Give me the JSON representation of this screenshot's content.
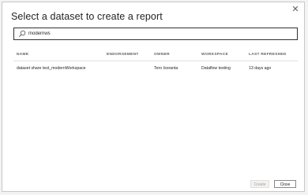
{
  "dialog": {
    "title": "Select a dataset to create a report",
    "close_glyph": "✕"
  },
  "search": {
    "value": "modernws",
    "icon": "search-icon"
  },
  "table": {
    "columns": {
      "name": "NAME",
      "endorsement": "ENDORSEMENT",
      "owner": "OWNER",
      "workspace": "WORKSPACE",
      "last_refreshed": "LAST REFRESHED"
    },
    "rows": [
      {
        "name": "dataset share test_modernWorkspace",
        "endorsement": "",
        "owner": "Tero Isoranta",
        "workspace": "Dataflow testing",
        "last_refreshed": "13 days ago"
      }
    ]
  },
  "buttons": {
    "create": "Create",
    "close": "Close"
  },
  "colors": {
    "primary_text": "#252423",
    "secondary_text": "#605e5c",
    "border": "#c8c8c8",
    "disabled_text": "#a19f9d"
  }
}
